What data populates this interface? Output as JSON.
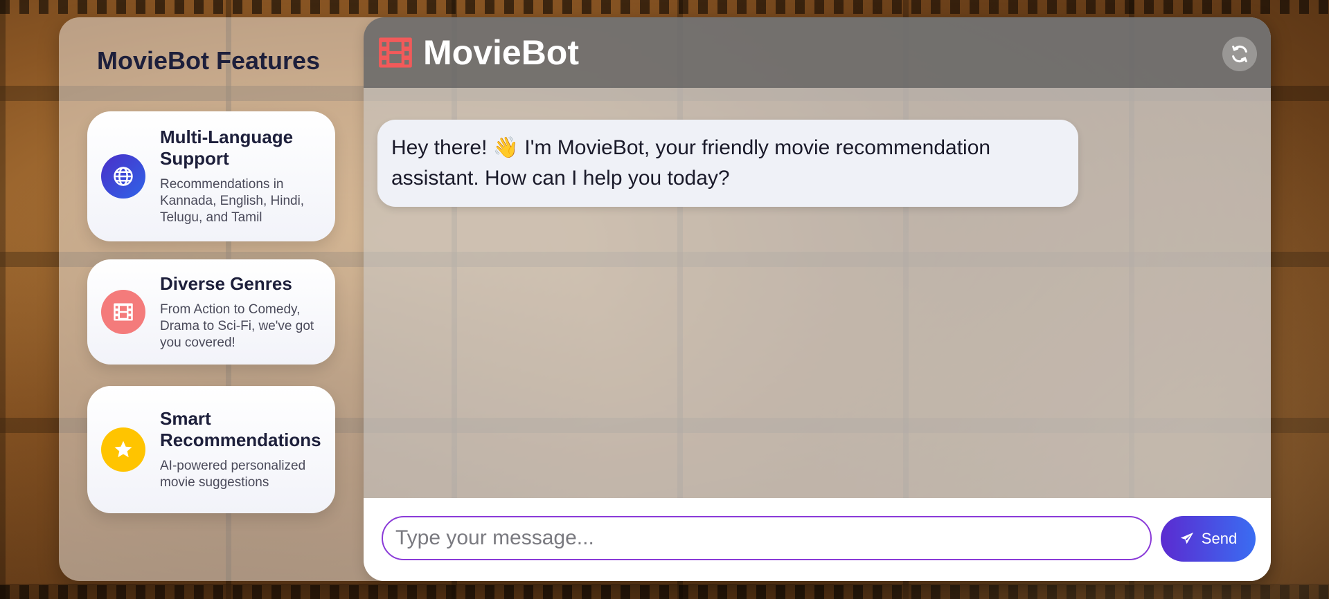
{
  "sidebar": {
    "title": "MovieBot Features",
    "features": [
      {
        "title": "Multi-Language Support",
        "description": "Recommendations in Kannada, English, Hindi, Telugu, and Tamil",
        "icon": "globe-icon",
        "color": "#3b3fd6"
      },
      {
        "title": "Diverse Genres",
        "description": "From Action to Comedy, Drama to Sci-Fi, we've got you covered!",
        "icon": "film-icon",
        "color": "#f47b7b"
      },
      {
        "title": "Smart Recommendations",
        "description": "AI-powered personalized movie suggestions",
        "icon": "star-icon",
        "color": "#ffc400"
      }
    ]
  },
  "header": {
    "title": "MovieBot",
    "logo_icon": "film-icon",
    "logo_color": "#f25a5a",
    "refresh_icon": "refresh-icon"
  },
  "messages": [
    {
      "sender": "bot",
      "text": "Hey there! 👋 I'm MovieBot, your friendly movie recommendation assistant. How can I help you today?"
    }
  ],
  "composer": {
    "placeholder": "Type your message...",
    "send_label": "Send",
    "send_icon": "paper-plane-icon"
  }
}
